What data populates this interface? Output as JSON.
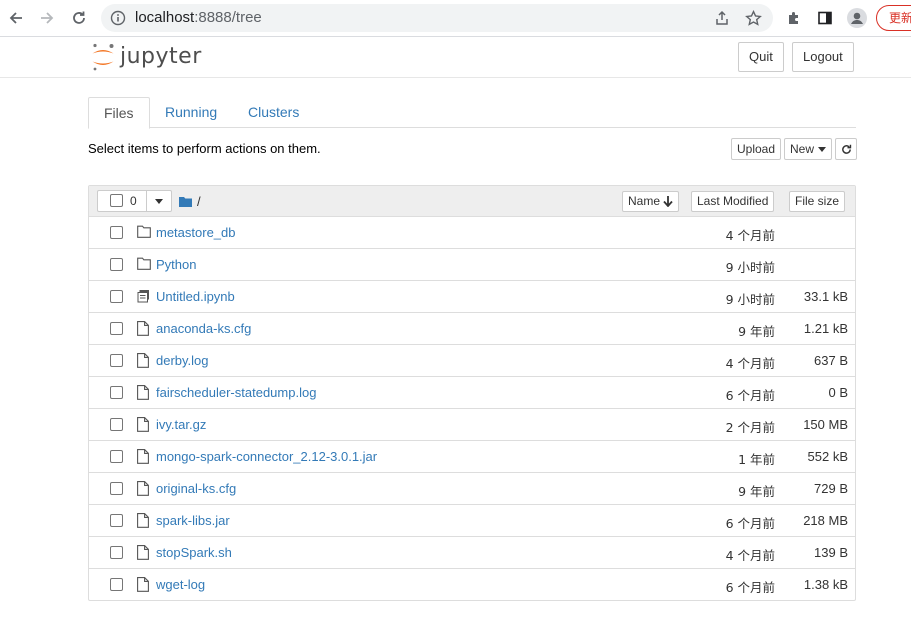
{
  "browser": {
    "url_host": "localhost",
    "url_rest": ":8888/tree",
    "update_label": "更新"
  },
  "header": {
    "logo_text": "jupyter",
    "quit_label": "Quit",
    "logout_label": "Logout"
  },
  "tabs": [
    {
      "label": "Files",
      "active": true
    },
    {
      "label": "Running",
      "active": false
    },
    {
      "label": "Clusters",
      "active": false
    }
  ],
  "toolbar": {
    "hint": "Select items to perform actions on them.",
    "upload_label": "Upload",
    "new_label": "New"
  },
  "list_header": {
    "selected_count": "0",
    "path": "/",
    "name_label": "Name",
    "modified_label": "Last Modified",
    "size_label": "File size"
  },
  "files": [
    {
      "name": "metastore_db",
      "type": "folder",
      "modified": "4 个月前",
      "size": ""
    },
    {
      "name": "Python",
      "type": "folder",
      "modified": "9 小时前",
      "size": ""
    },
    {
      "name": "Untitled.ipynb",
      "type": "notebook",
      "modified": "9 小时前",
      "size": "33.1 kB"
    },
    {
      "name": "anaconda-ks.cfg",
      "type": "file",
      "modified": "9 年前",
      "size": "1.21 kB"
    },
    {
      "name": "derby.log",
      "type": "file",
      "modified": "4 个月前",
      "size": "637 B"
    },
    {
      "name": "fairscheduler-statedump.log",
      "type": "file",
      "modified": "6 个月前",
      "size": "0 B"
    },
    {
      "name": "ivy.tar.gz",
      "type": "file",
      "modified": "2 个月前",
      "size": "150 MB"
    },
    {
      "name": "mongo-spark-connector_2.12-3.0.1.jar",
      "type": "file",
      "modified": "1 年前",
      "size": "552 kB"
    },
    {
      "name": "original-ks.cfg",
      "type": "file",
      "modified": "9 年前",
      "size": "729 B"
    },
    {
      "name": "spark-libs.jar",
      "type": "file",
      "modified": "6 个月前",
      "size": "218 MB"
    },
    {
      "name": "stopSpark.sh",
      "type": "file",
      "modified": "4 个月前",
      "size": "139 B"
    },
    {
      "name": "wget-log",
      "type": "file",
      "modified": "6 个月前",
      "size": "1.38 kB"
    }
  ],
  "colors": {
    "link": "#337ab7",
    "jupyter_orange": "#f37726",
    "folder_icon": "#337ab7"
  }
}
